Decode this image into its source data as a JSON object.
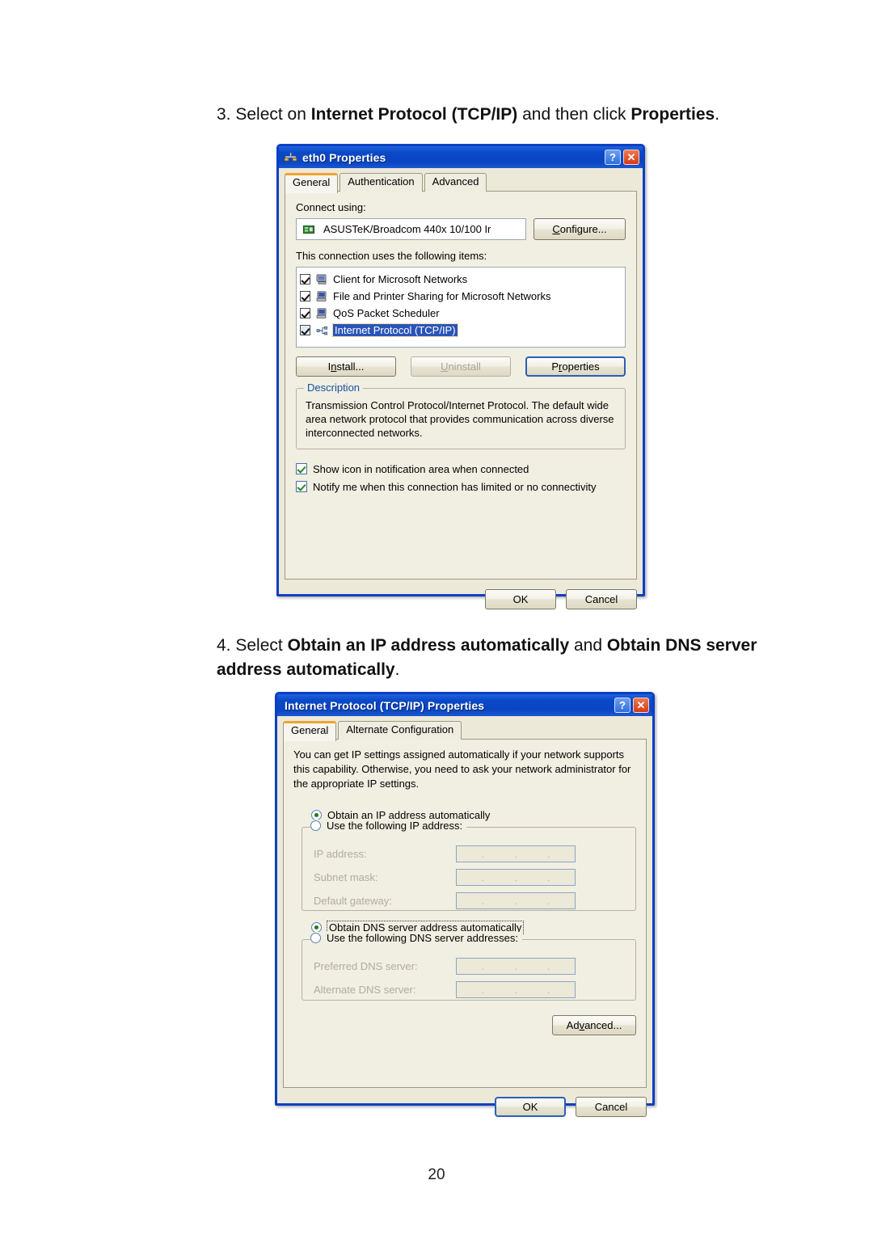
{
  "page": {
    "number": "20",
    "step3": {
      "parts": [
        {
          "t": "3. Select on ",
          "b": false
        },
        {
          "t": "Internet Protocol (TCP/IP)",
          "b": true
        },
        {
          "t": " and then click ",
          "b": false
        },
        {
          "t": "Properties",
          "b": true
        },
        {
          "t": ".",
          "b": false
        }
      ],
      "plain": "3. Select on Internet Protocol (TCP/IP) and then click Properties."
    },
    "step4": {
      "parts": [
        {
          "t": "4. Select ",
          "b": false
        },
        {
          "t": "Obtain an IP address automatically",
          "b": true
        },
        {
          "t": " and ",
          "b": false
        },
        {
          "t": "Obtain DNS server address automatically",
          "b": true
        },
        {
          "t": ".",
          "b": false
        }
      ],
      "plain": "4. Select Obtain an IP address automatically and Obtain DNS server address automatically."
    }
  },
  "colors": {
    "titlebar_blue": "#0a49c8",
    "dialog_border": "#0b3fc4",
    "dialog_face": "#ece9d8",
    "tab_active_accent": "#f0a330",
    "selection_blue": "#2a54b8",
    "legend_blue": "#15509e",
    "close_button_red": "#d63a18"
  },
  "dialog1": {
    "title": "eth0 Properties",
    "title_icon": "network-connection-icon",
    "help_button": "?",
    "close_button": "✕",
    "tabs": [
      {
        "label": "General",
        "active": true
      },
      {
        "label": "Authentication",
        "active": false
      },
      {
        "label": "Advanced",
        "active": false
      }
    ],
    "connect_using_label": "Connect using:",
    "adapter": {
      "icon": "network-adapter-icon",
      "name": "ASUSTeK/Broadcom 440x 10/100 Ir"
    },
    "configure_button": "Configure...",
    "items_label": "This connection uses the following items:",
    "items": [
      {
        "label": "Client for Microsoft Networks",
        "checked": true,
        "selected": false,
        "icon": "computer-icon"
      },
      {
        "label": "File and Printer Sharing for Microsoft Networks",
        "checked": true,
        "selected": false,
        "icon": "computer-icon"
      },
      {
        "label": "QoS Packet Scheduler",
        "checked": true,
        "selected": false,
        "icon": "computer-icon"
      },
      {
        "label": "Internet Protocol (TCP/IP)",
        "checked": true,
        "selected": true,
        "icon": "protocol-icon"
      }
    ],
    "buttons": {
      "install": "Install...",
      "uninstall": "Uninstall",
      "properties": "Properties"
    },
    "description": {
      "legend": "Description",
      "text": "Transmission Control Protocol/Internet Protocol. The default wide area network protocol that provides communication across diverse interconnected networks."
    },
    "checkboxes": [
      {
        "label": "Show icon in notification area when connected",
        "checked": true
      },
      {
        "label": "Notify me when this connection has limited or no connectivity",
        "checked": true
      }
    ],
    "ok_button": "OK",
    "cancel_button": "Cancel"
  },
  "dialog2": {
    "title": "Internet Protocol (TCP/IP) Properties",
    "help_button": "?",
    "close_button": "✕",
    "tabs": [
      {
        "label": "General",
        "active": true
      },
      {
        "label": "Alternate Configuration",
        "active": false
      }
    ],
    "intro": "You can get IP settings assigned automatically if your network supports this capability. Otherwise, you need to ask your network administrator for the appropriate IP settings.",
    "ip_auto_radio": {
      "label": "Obtain an IP address automatically",
      "selected": true
    },
    "ip_manual_radio": {
      "label": "Use the following IP address:",
      "selected": false
    },
    "ip_fields": [
      {
        "label": "IP address:",
        "value": ""
      },
      {
        "label": "Subnet mask:",
        "value": ""
      },
      {
        "label": "Default gateway:",
        "value": ""
      }
    ],
    "dns_auto_radio": {
      "label": "Obtain DNS server address automatically",
      "selected": true,
      "focused": true
    },
    "dns_manual_radio": {
      "label": "Use the following DNS server addresses:",
      "selected": false
    },
    "dns_fields": [
      {
        "label": "Preferred DNS server:",
        "value": ""
      },
      {
        "label": "Alternate DNS server:",
        "value": ""
      }
    ],
    "advanced_button": "Advanced...",
    "ok_button": "OK",
    "cancel_button": "Cancel"
  }
}
